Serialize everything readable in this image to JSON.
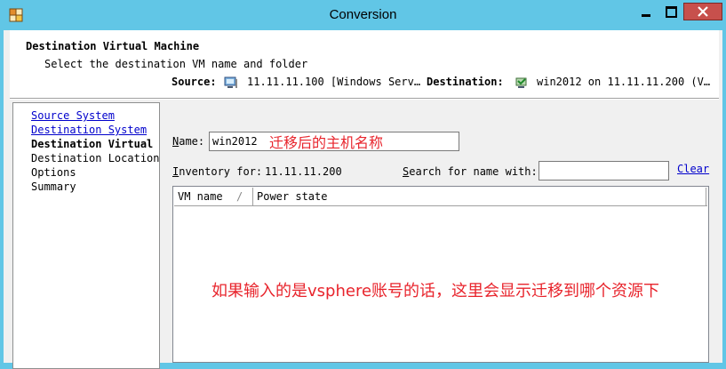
{
  "window": {
    "title": "Conversion"
  },
  "header": {
    "title": "Destination Virtual Machine",
    "subtitle": "Select the destination VM name and folder"
  },
  "steps": [
    {
      "label": "Source System",
      "state": "link"
    },
    {
      "label": "Destination System",
      "state": "link"
    },
    {
      "label": "Destination Virtual Machine",
      "state": "current"
    },
    {
      "label": "Destination Location",
      "state": "pending"
    },
    {
      "label": "Options",
      "state": "pending"
    },
    {
      "label": "Summary",
      "state": "pending"
    }
  ],
  "summary": {
    "source_label": "Source:",
    "source_value": "11.11.11.100 [Windows Serv…",
    "destination_label": "Destination:",
    "destination_value": "win2012 on 11.11.11.200 (V…"
  },
  "form": {
    "name_label_u": "N",
    "name_label_rest": "ame:",
    "name_value": "win2012",
    "name_annotation": "迁移后的主机名称",
    "inventory_label_u": "I",
    "inventory_label_rest": "nventory for:",
    "inventory_value": "11.11.11.200",
    "search_label_u": "S",
    "search_label_rest": "earch for name with:",
    "search_value": "",
    "clear_label": "Clear"
  },
  "vm_table": {
    "columns": [
      "VM name",
      "Power state"
    ],
    "sort_indicator": "/",
    "rows": [],
    "annotation": "如果输入的是vsphere账号的话，这里会显示迁移到哪个资源下"
  },
  "icons": {
    "app": "converter-app-icon",
    "source": "physical-machine-icon",
    "destination": "virtual-machine-icon"
  },
  "colors": {
    "titlebar": "#61c6e6",
    "close_button": "#c7504c",
    "link": "#0000cc",
    "annotation": "#e8242c"
  }
}
